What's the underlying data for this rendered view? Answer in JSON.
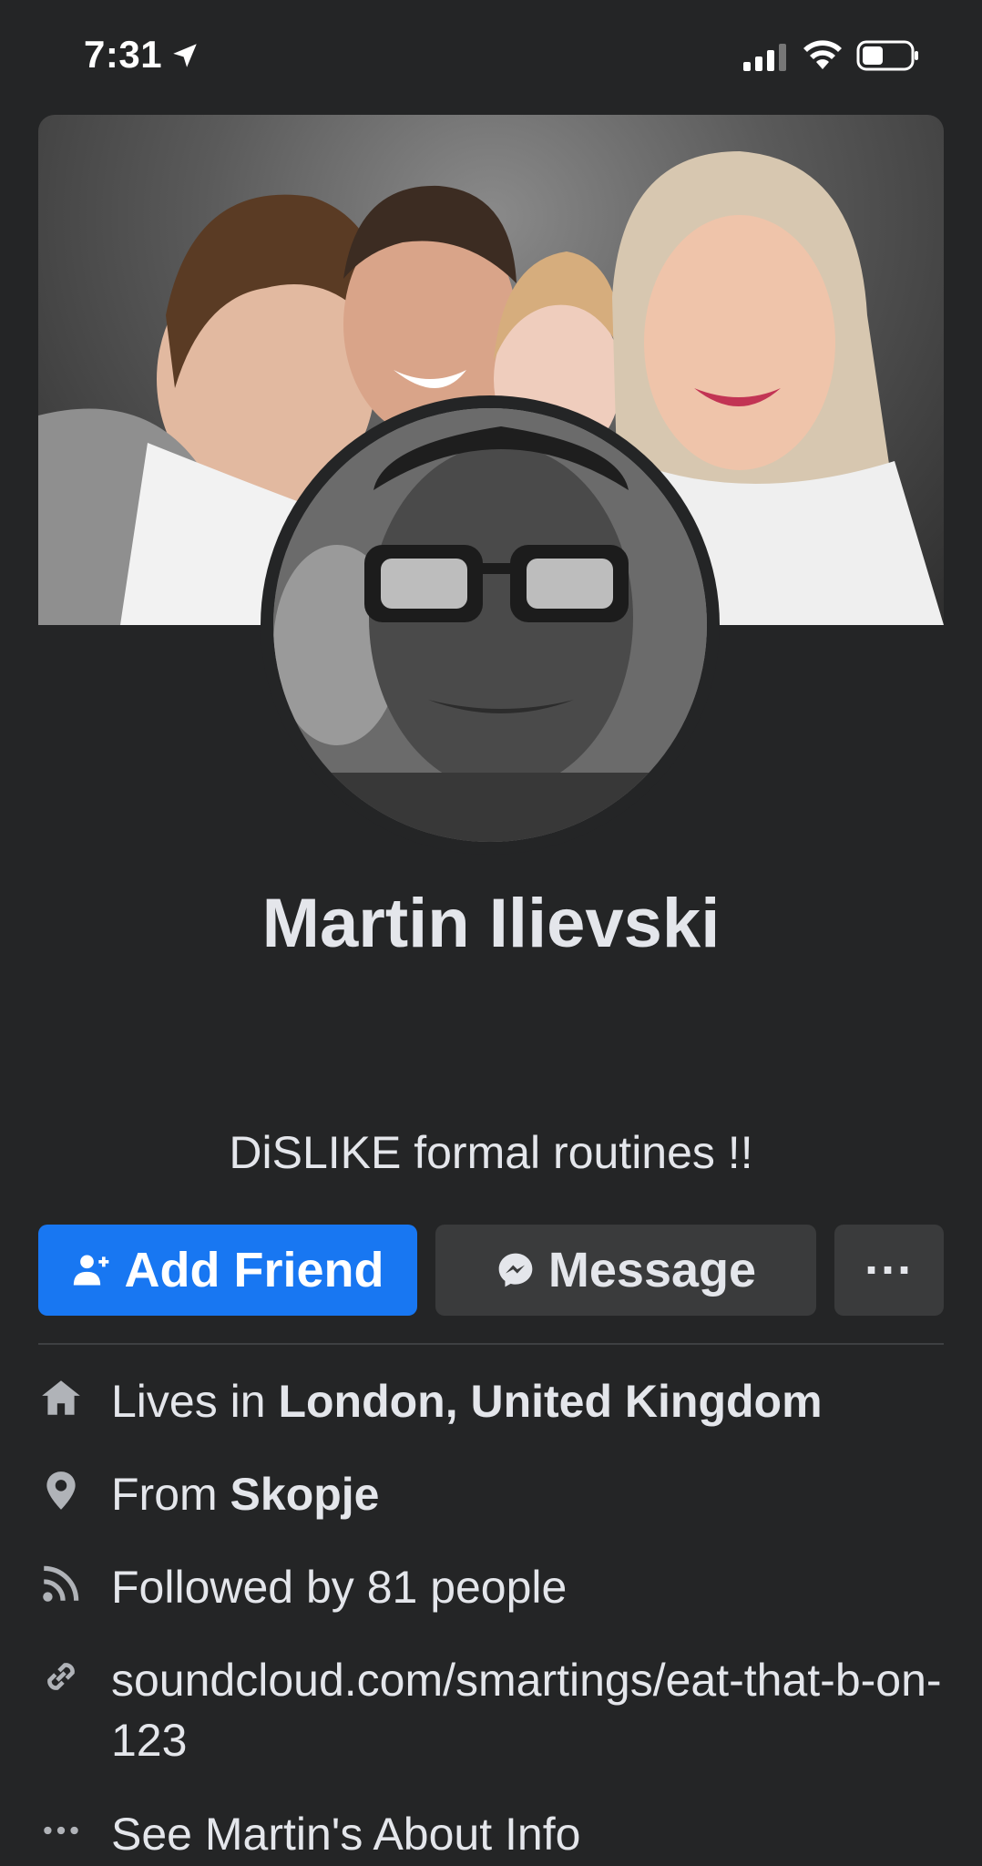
{
  "status_bar": {
    "time": "7:31"
  },
  "profile": {
    "name": "Martin Ilievski",
    "bio": "DiSLIKE formal routines !!"
  },
  "actions": {
    "add_friend_label": "Add Friend",
    "message_label": "Message",
    "more_label": "···"
  },
  "intro": {
    "lives_prefix": "Lives in ",
    "lives_place": "London, United Kingdom",
    "from_prefix": "From ",
    "from_place": "Skopje",
    "followed": "Followed by 81 people",
    "link": "soundcloud.com/smartings/eat-that-b-on-123",
    "about": "See Martin's About Info"
  },
  "colors": {
    "background": "#242526",
    "primary_button": "#1877f2",
    "secondary_button": "#3a3b3c",
    "text": "#e4e6eb",
    "icon": "#b0b3b8"
  },
  "icons": {
    "location": "location-arrow-icon",
    "signal": "cellular-signal-icon",
    "wifi": "wifi-icon",
    "battery": "battery-icon",
    "add_friend": "add-friend-icon",
    "messenger": "messenger-icon",
    "home": "home-icon",
    "pin": "map-pin-icon",
    "rss": "followers-feed-icon",
    "link": "link-icon",
    "more": "more-dots-icon"
  }
}
